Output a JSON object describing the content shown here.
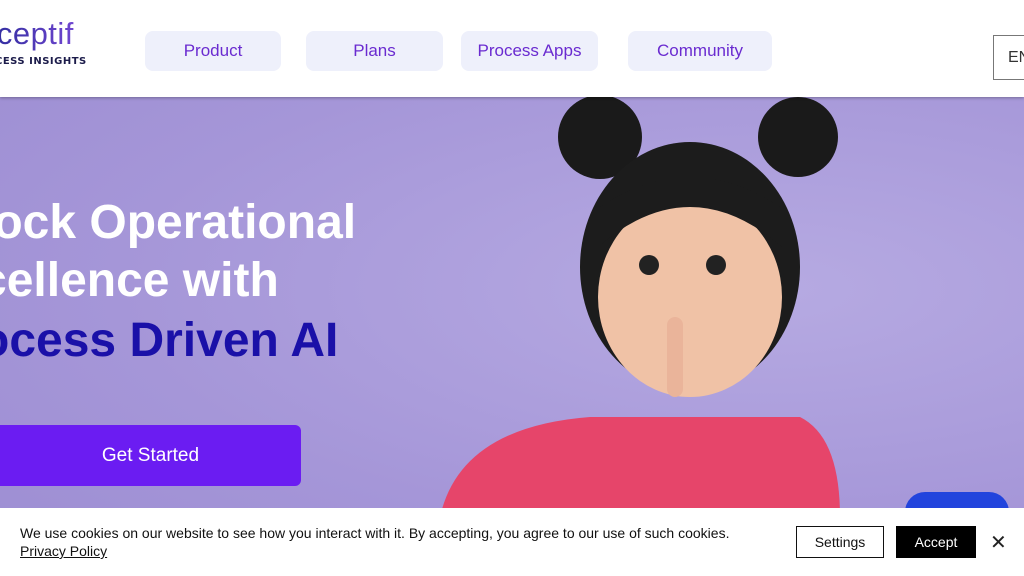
{
  "header": {
    "logo": "rceptif",
    "logo_sub": "OCESS INSIGHTS",
    "nav": [
      "Product",
      "Plans",
      "Process Apps",
      "Community"
    ],
    "lang": "EN"
  },
  "hero": {
    "line1": "lock Operational",
    "line2": "cellence with",
    "line3": "ocess Driven AI",
    "cta": "Get Started"
  },
  "cookie": {
    "text": "We use cookies on our website to see how you interact with it. By accepting, you agree to our use of such cookies.",
    "privacy": "Privacy Policy",
    "settings": "Settings",
    "accept": "Accept",
    "close": "✕"
  }
}
